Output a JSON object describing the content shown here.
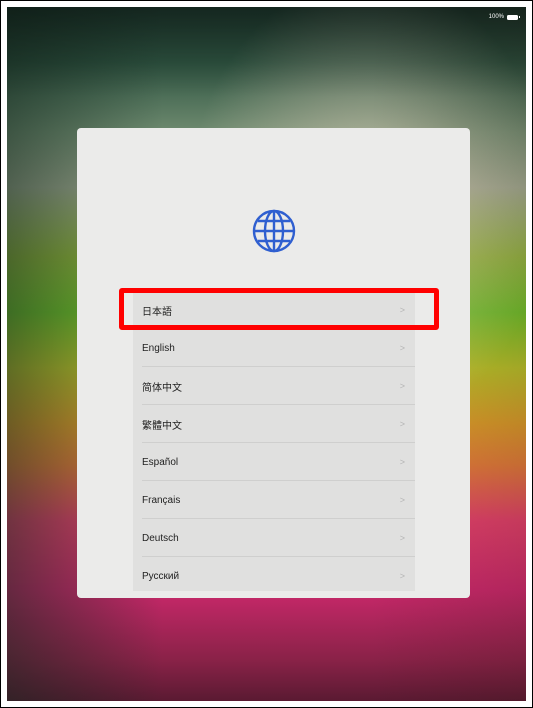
{
  "status_bar": {
    "battery_percent": "100%"
  },
  "setup_dialog": {
    "icon": "globe-icon",
    "languages": [
      {
        "label": "日本語"
      },
      {
        "label": "English"
      },
      {
        "label": "简体中文"
      },
      {
        "label": "繁體中文"
      },
      {
        "label": "Español"
      },
      {
        "label": "Français"
      },
      {
        "label": "Deutsch"
      },
      {
        "label": "Русский"
      }
    ],
    "highlighted_language": "日本語"
  },
  "colors": {
    "highlight": "#ff0000",
    "globe": "#2f5fd0",
    "dialog_background": "#ebebea"
  }
}
